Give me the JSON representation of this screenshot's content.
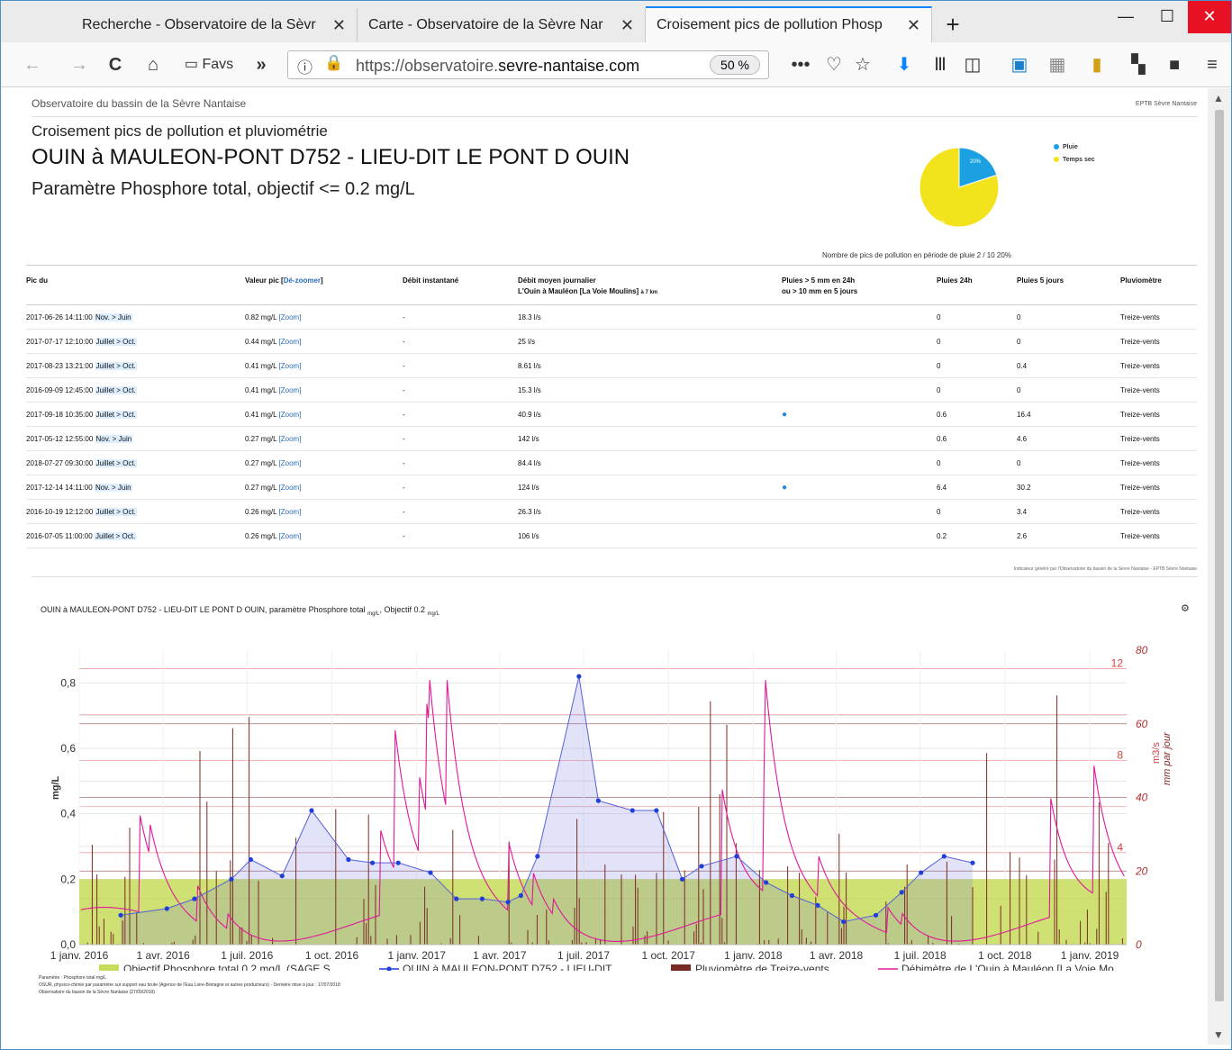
{
  "browser": {
    "tabs": [
      {
        "title": "Recherche - Observatoire de la Sèvr",
        "active": false
      },
      {
        "title": "Carte - Observatoire de la Sèvre Nar",
        "active": false
      },
      {
        "title": "Croisement pics de pollution Phosp",
        "active": true
      }
    ],
    "url_prefix": "https://observatoire.",
    "url_domain": "sevre-nantaise.com",
    "zoom": "50 %",
    "favs_label": "Favs"
  },
  "page": {
    "site_header": "Observatoire du bassin de la Sèvre Nantaise",
    "org_name": "EPTB Sèvre Nantaise",
    "page_title": "Croisement pics de pollution et pluviométrie",
    "station_title": "OUIN à MAULEON-PONT D752 - LIEU-DIT LE PONT D OUIN",
    "param_title": "Paramètre Phosphore total, objectif <= 0.2 mg/L",
    "pie": {
      "slices": [
        {
          "label": "Pluie",
          "value": 20,
          "text": "20%",
          "color": "#1ba1e2"
        },
        {
          "label": "Temps sec",
          "value": 80,
          "text": "80%",
          "color": "#f2e31c"
        }
      ],
      "caption": "Nombre de pics de pollution en période de pluie 2 / 10 20%"
    },
    "table": {
      "headers": [
        "Pic du",
        "Valeur pic [",
        "Dé-zoomer",
        "]",
        "Débit instantané",
        "Débit moyen journalier",
        "L'Ouin à Mauléon [La Voie Moulins]",
        "à 7 km",
        "Pluies > 5 mm en 24h",
        "ou > 10 mm en 5 jours",
        "Pluies 24h",
        "Pluies 5 jours",
        "Pluviomètre"
      ],
      "zoom_label": "[Zoom]",
      "rows": [
        {
          "date": "2017-06-26 14:11:00",
          "season": "Nov. > Juin",
          "value": "0.82 mg/L",
          "inst": "-",
          "flow": "18.3 l/s",
          "rain_icon": false,
          "r24": "0",
          "r5": "0",
          "gauge": "Treize-vents"
        },
        {
          "date": "2017-07-17 12:10:00",
          "season": "Juillet > Oct.",
          "value": "0.44 mg/L",
          "inst": "-",
          "flow": "25 l/s",
          "rain_icon": false,
          "r24": "0",
          "r5": "0",
          "gauge": "Treize-vents"
        },
        {
          "date": "2017-08-23 13:21:00",
          "season": "Juillet > Oct.",
          "value": "0.41 mg/L",
          "inst": "-",
          "flow": "8.61 l/s",
          "rain_icon": false,
          "r24": "0",
          "r5": "0.4",
          "gauge": "Treize-vents"
        },
        {
          "date": "2016-09-09 12:45:00",
          "season": "Juillet > Oct.",
          "value": "0.41 mg/L",
          "inst": "-",
          "flow": "15.3 l/s",
          "rain_icon": false,
          "r24": "0",
          "r5": "0",
          "gauge": "Treize-vents"
        },
        {
          "date": "2017-09-18 10:35:00",
          "season": "Juillet > Oct.",
          "value": "0.41 mg/L",
          "inst": "-",
          "flow": "40.9 l/s",
          "rain_icon": true,
          "r24": "0.6",
          "r5": "16.4",
          "gauge": "Treize-vents"
        },
        {
          "date": "2017-05-12 12:55:00",
          "season": "Nov. > Juin",
          "value": "0.27 mg/L",
          "inst": "-",
          "flow": "142 l/s",
          "rain_icon": false,
          "r24": "0.6",
          "r5": "4.6",
          "gauge": "Treize-vents"
        },
        {
          "date": "2018-07-27 09:30:00",
          "season": "Juillet > Oct.",
          "value": "0.27 mg/L",
          "inst": "-",
          "flow": "84.4 l/s",
          "rain_icon": false,
          "r24": "0",
          "r5": "0",
          "gauge": "Treize-vents"
        },
        {
          "date": "2017-12-14 14:11:00",
          "season": "Nov. > Juin",
          "value": "0.27 mg/L",
          "inst": "-",
          "flow": "124 l/s",
          "rain_icon": true,
          "r24": "6.4",
          "r5": "30.2",
          "gauge": "Treize-vents"
        },
        {
          "date": "2016-10-19 12:12:00",
          "season": "Juillet > Oct.",
          "value": "0.26 mg/L",
          "inst": "-",
          "flow": "26.3 l/s",
          "rain_icon": false,
          "r24": "0",
          "r5": "3.4",
          "gauge": "Treize-vents"
        },
        {
          "date": "2016-07-05 11:00:00",
          "season": "Juillet > Oct.",
          "value": "0.26 mg/L",
          "inst": "-",
          "flow": "106 l/s",
          "rain_icon": false,
          "r24": "0.2",
          "r5": "2.6",
          "gauge": "Treize-vents"
        }
      ]
    },
    "source_line": "Indicateur généré par l'Observatoire du bassin de la Sèvre Nantaise - EPTB Sèvre Nantaise",
    "notes": [
      "Paramètre : Phosphore total mg/L",
      "OSUR, physico-chimie par paramètre sur support eau brute (Agence de l'Eau Loire-Bretagne et autres producteurs) - Dernière mise à jour : 17/07/2018",
      "Observatoire du bassin de la Sèvre Nantaise (27/09/2019)"
    ]
  },
  "chart_data": {
    "type": "line",
    "title_main": "OUIN à MAULEON-PONT D752 - LIEU-DIT LE PONT D OUIN, paramètre Phosphore total",
    "title_unit": "mg/L",
    "title_obj": ", Objectif 0.2",
    "ylabel": "mg/L",
    "y2label": "m3/s",
    "y3label": "mm par jour",
    "ylim": [
      0,
      0.9
    ],
    "y_ticks": [
      "0,0",
      "0,2",
      "0,4",
      "0,6",
      "0,8"
    ],
    "y2_ticks": [
      "4",
      "8",
      "12"
    ],
    "y3_ticks": [
      "0",
      "20",
      "40",
      "60",
      "80"
    ],
    "x_ticks": [
      "1 janv. 2016",
      "1 avr. 2016",
      "1 juil. 2016",
      "1 oct. 2016",
      "1 janv. 2017",
      "1 avr. 2017",
      "1 juil. 2017",
      "1 oct. 2017",
      "1 janv. 2018",
      "1 avr. 2018",
      "1 juil. 2018",
      "1 oct. 2018",
      "1 janv. 2019"
    ],
    "x_range": [
      "2016-01-01",
      "2019-02-10"
    ],
    "objective": 0.2,
    "series": [
      {
        "name": "Objectif Phosphore total 0.2 mg/L (SAGE S...",
        "color": "#a8c81a"
      },
      {
        "name": "OUIN à MAULEON-PONT D752 - LIEU-DIT...",
        "color": "#1f3fd8",
        "x": [
          "2016-02-15",
          "2016-04-05",
          "2016-05-05",
          "2016-06-14",
          "2016-07-05",
          "2016-08-08",
          "2016-09-09",
          "2016-10-19",
          "2016-11-14",
          "2016-12-12",
          "2017-01-16",
          "2017-02-13",
          "2017-03-13",
          "2017-04-10",
          "2017-04-24",
          "2017-05-12",
          "2017-06-26",
          "2017-07-17",
          "2017-08-23",
          "2017-09-18",
          "2017-10-16",
          "2017-11-06",
          "2017-12-14",
          "2018-01-15",
          "2018-02-12",
          "2018-03-12",
          "2018-04-09",
          "2018-05-14",
          "2018-06-11",
          "2018-07-02",
          "2018-07-27",
          "2018-08-27"
        ],
        "values": [
          0.09,
          0.11,
          0.14,
          0.2,
          0.26,
          0.21,
          0.41,
          0.26,
          0.25,
          0.25,
          0.22,
          0.14,
          0.14,
          0.13,
          0.15,
          0.27,
          0.82,
          0.44,
          0.41,
          0.41,
          0.2,
          0.24,
          0.27,
          0.19,
          0.15,
          0.12,
          0.07,
          0.09,
          0.16,
          0.22,
          0.27,
          0.25
        ]
      },
      {
        "name": "Pluviomètre de Treize-vents",
        "color": "#7a2a24"
      },
      {
        "name": "Débimètre de L'Ouin à Mauléon [La Voie Mo...",
        "color": "#e0189a"
      }
    ]
  }
}
